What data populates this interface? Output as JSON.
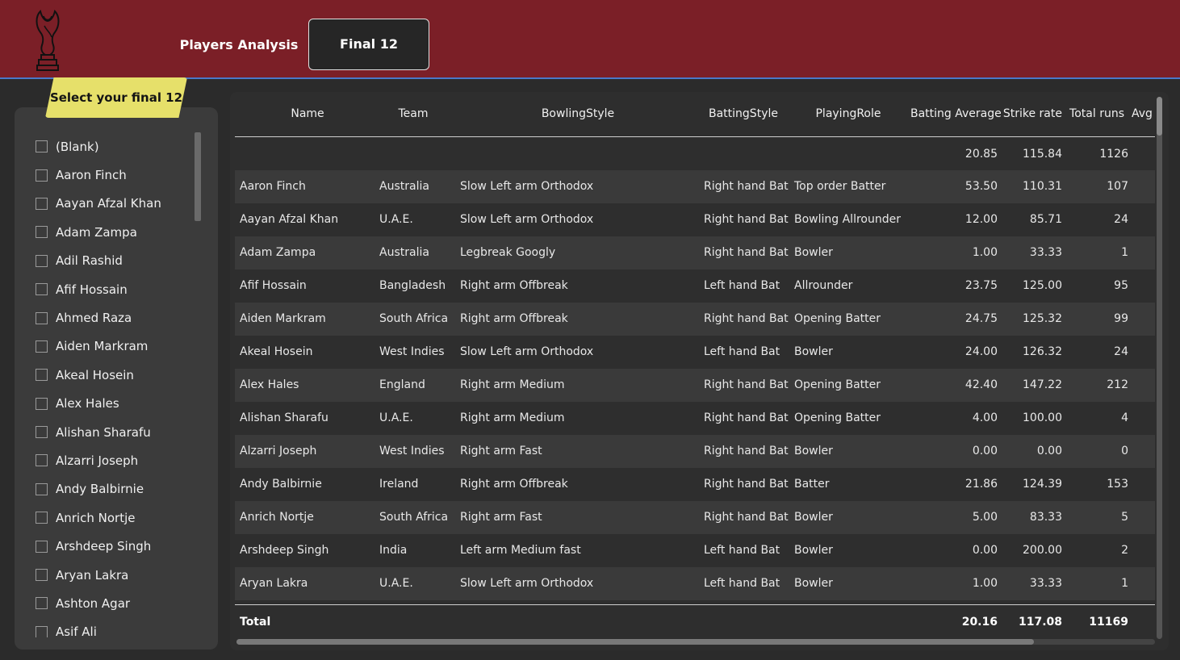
{
  "header": {
    "nav_players": "Players Analysis",
    "nav_final": "Final 12",
    "colors": {
      "header_bg": "#7b1f27",
      "active_tab_bg": "#262626",
      "badge_bg": "#e6e06a"
    }
  },
  "slicer": {
    "title": "Select your final 12",
    "items": [
      "(Blank)",
      "Aaron Finch",
      "Aayan Afzal Khan",
      "Adam Zampa",
      "Adil Rashid",
      "Afif Hossain",
      "Ahmed Raza",
      "Aiden Markram",
      "Akeal Hosein",
      "Alex Hales",
      "Alishan Sharafu",
      "Alzarri Joseph",
      "Andy Balbirnie",
      "Anrich Nortje",
      "Arshdeep Singh",
      "Aryan Lakra",
      "Ashton Agar",
      "Asif Ali"
    ]
  },
  "table": {
    "columns": [
      "Name",
      "Team",
      "BowlingStyle",
      "BattingStyle",
      "PlayingRole",
      "Batting Average",
      "Strike rate",
      "Total runs",
      "Avg"
    ],
    "summary": {
      "batting_average": "20.85",
      "strike_rate": "115.84",
      "total_runs": "1126"
    },
    "rows": [
      [
        "Aaron Finch",
        "Australia",
        "Slow Left arm Orthodox",
        "Right hand Bat",
        "Top order Batter",
        "53.50",
        "110.31",
        "107"
      ],
      [
        "Aayan Afzal Khan",
        "U.A.E.",
        "Slow Left arm Orthodox",
        "Right hand Bat",
        "Bowling Allrounder",
        "12.00",
        "85.71",
        "24"
      ],
      [
        "Adam Zampa",
        "Australia",
        "Legbreak Googly",
        "Right hand Bat",
        "Bowler",
        "1.00",
        "33.33",
        "1"
      ],
      [
        "Afif Hossain",
        "Bangladesh",
        "Right arm Offbreak",
        "Left hand Bat",
        "Allrounder",
        "23.75",
        "125.00",
        "95"
      ],
      [
        "Aiden Markram",
        "South Africa",
        "Right arm Offbreak",
        "Right hand Bat",
        "Opening Batter",
        "24.75",
        "125.32",
        "99"
      ],
      [
        "Akeal Hosein",
        "West Indies",
        "Slow Left arm Orthodox",
        "Left hand Bat",
        "Bowler",
        "24.00",
        "126.32",
        "24"
      ],
      [
        "Alex Hales",
        "England",
        "Right arm Medium",
        "Right hand Bat",
        "Opening Batter",
        "42.40",
        "147.22",
        "212"
      ],
      [
        "Alishan Sharafu",
        "U.A.E.",
        "Right arm Medium",
        "Right hand Bat",
        "Opening Batter",
        "4.00",
        "100.00",
        "4"
      ],
      [
        "Alzarri Joseph",
        "West Indies",
        "Right arm Fast",
        "Right hand Bat",
        "Bowler",
        "0.00",
        "0.00",
        "0"
      ],
      [
        "Andy Balbirnie",
        "Ireland",
        "Right arm Offbreak",
        "Right hand Bat",
        "Batter",
        "21.86",
        "124.39",
        "153"
      ],
      [
        "Anrich Nortje",
        "South Africa",
        "Right arm Fast",
        "Right hand Bat",
        "Bowler",
        "5.00",
        "83.33",
        "5"
      ],
      [
        "Arshdeep Singh",
        "India",
        "Left arm Medium fast",
        "Left hand Bat",
        "Bowler",
        "0.00",
        "200.00",
        "2"
      ],
      [
        "Aryan Lakra",
        "U.A.E.",
        "Slow Left arm Orthodox",
        "Left hand Bat",
        "Bowler",
        "1.00",
        "33.33",
        "1"
      ]
    ],
    "total": {
      "label": "Total",
      "batting_average": "20.16",
      "strike_rate": "117.08",
      "total_runs": "11169"
    }
  },
  "icons": {
    "logo": "trophy-icon"
  }
}
